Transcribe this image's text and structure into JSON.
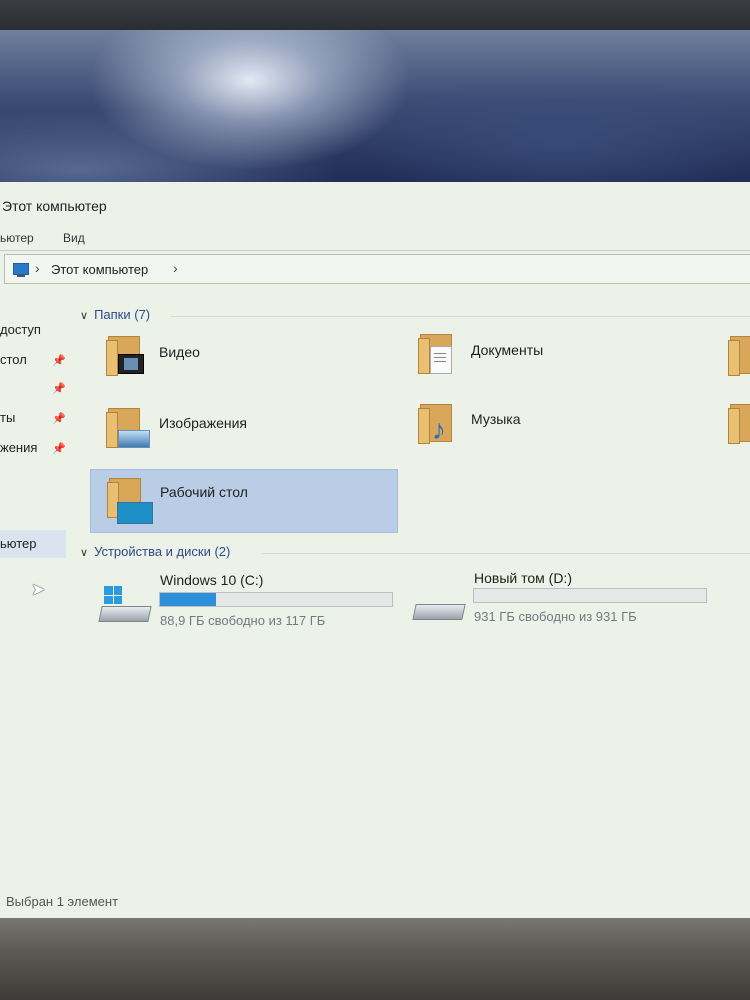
{
  "window": {
    "title": "Этот компьютер",
    "menu": [
      "ьютер",
      "Вид"
    ],
    "address": "Этот компьютер"
  },
  "nav": {
    "items": [
      {
        "label": "доступ",
        "pinned": false
      },
      {
        "label": "стол",
        "pinned": true
      },
      {
        "label": "",
        "pinned": true
      },
      {
        "label": "ты",
        "pinned": true
      },
      {
        "label": "жения",
        "pinned": true
      },
      {
        "label": "ьютер",
        "pinned": false,
        "selected": true
      }
    ]
  },
  "folders_group": {
    "header": "Папки (7)",
    "items": [
      {
        "label": "Видео",
        "icon": "video-folder-icon"
      },
      {
        "label": "Документы",
        "icon": "documents-folder-icon"
      },
      {
        "label": "Изображения",
        "icon": "pictures-folder-icon"
      },
      {
        "label": "Музыка",
        "icon": "music-folder-icon"
      },
      {
        "label": "Рабочий стол",
        "icon": "desktop-folder-icon",
        "selected": true
      }
    ]
  },
  "drives_group": {
    "header": "Устройства и диски (2)",
    "drives": [
      {
        "name": "Windows 10 (C:)",
        "free_text": "88,9 ГБ свободно из 117 ГБ",
        "used_fraction": 0.24,
        "icon": "windows-drive-icon"
      },
      {
        "name": "Новый том (D:)",
        "free_text": "931 ГБ свободно из 931 ГБ",
        "used_fraction": 0.0,
        "icon": "hard-drive-icon"
      }
    ]
  },
  "status": "Выбран 1 элемент",
  "colors": {
    "accent": "#2d8fd8",
    "selection": "#b9cde6",
    "background": "#edf2e9"
  }
}
